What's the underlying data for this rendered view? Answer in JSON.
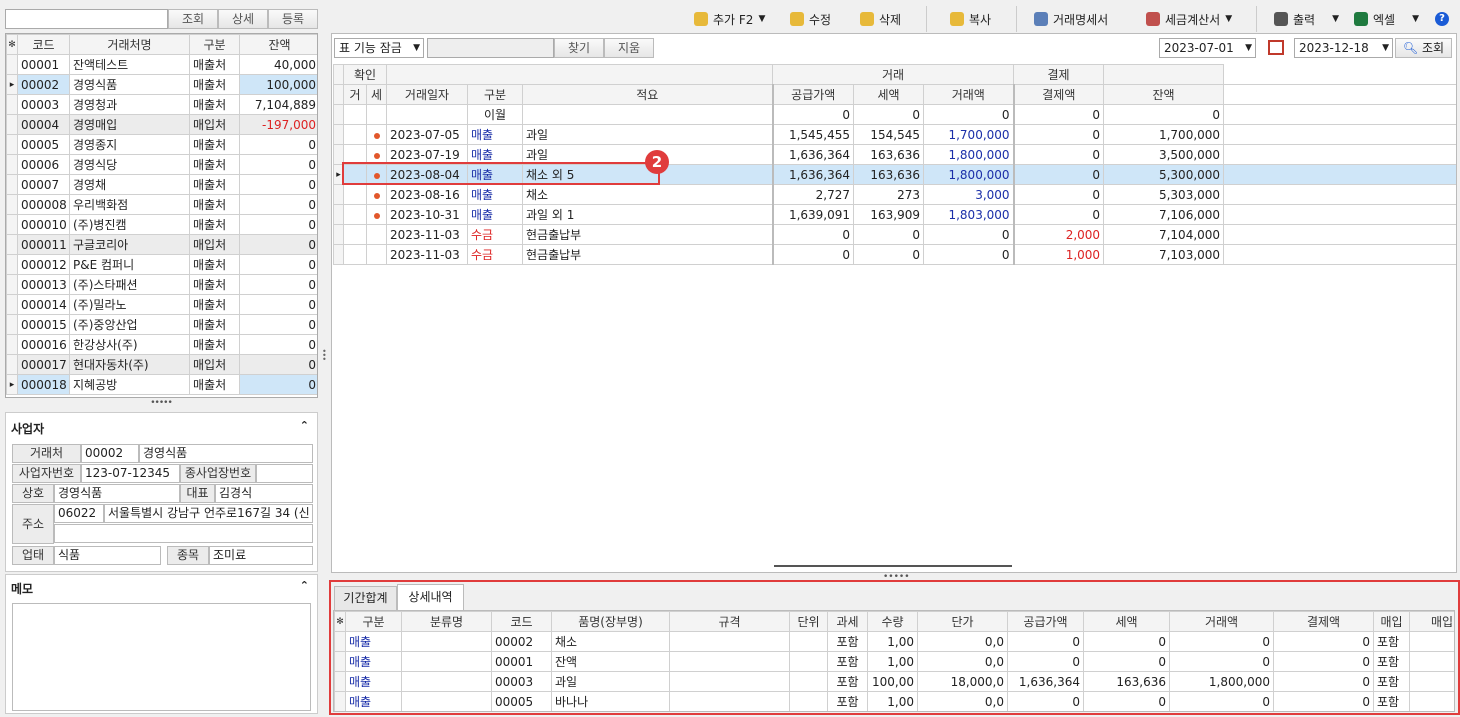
{
  "left": {
    "search_value": "",
    "btn_search": "조회",
    "btn_detail": "상세",
    "btn_register": "등록",
    "headers": [
      "코드",
      "거래처명",
      "구분",
      "잔액"
    ],
    "rows": [
      {
        "code": "00001",
        "name": "잔액테스트",
        "type": "매출처",
        "bal": "40,000"
      },
      {
        "code": "00002",
        "name": "경영식품",
        "type": "매출처",
        "bal": "100,000"
      },
      {
        "code": "00003",
        "name": "경영청과",
        "type": "매출처",
        "bal": "7,104,889"
      },
      {
        "code": "00004",
        "name": "경영매입",
        "type": "매입처",
        "bal": "-197,000"
      },
      {
        "code": "00005",
        "name": "경영종지",
        "type": "매출처",
        "bal": "0"
      },
      {
        "code": "00006",
        "name": "경영식당",
        "type": "매출처",
        "bal": "0"
      },
      {
        "code": "00007",
        "name": "경영채",
        "type": "매출처",
        "bal": "0"
      },
      {
        "code": "000008",
        "name": "우리백화점",
        "type": "매출처",
        "bal": "0"
      },
      {
        "code": "000010",
        "name": "(주)병진캠",
        "type": "매출처",
        "bal": "0"
      },
      {
        "code": "000011",
        "name": "구글코리아",
        "type": "매입처",
        "bal": "0"
      },
      {
        "code": "000012",
        "name": "P&E 컴퍼니",
        "type": "매출처",
        "bal": "0"
      },
      {
        "code": "000013",
        "name": "(주)스타패션",
        "type": "매출처",
        "bal": "0"
      },
      {
        "code": "000014",
        "name": "(주)밀라노",
        "type": "매출처",
        "bal": "0"
      },
      {
        "code": "000015",
        "name": "(주)중앙산업",
        "type": "매출처",
        "bal": "0"
      },
      {
        "code": "000016",
        "name": "한강상사(주)",
        "type": "매출처",
        "bal": "0"
      },
      {
        "code": "000017",
        "name": "현대자동차(주)",
        "type": "매입처",
        "bal": "0"
      },
      {
        "code": "000018",
        "name": "지혜공방",
        "type": "매출처",
        "bal": "0"
      }
    ]
  },
  "biz": {
    "title": "사업자",
    "client_label": "거래처",
    "client_code": "00002",
    "client_name": "경영식품",
    "bizno_label": "사업자번호",
    "bizno": "123-07-12345",
    "subbiz_label": "종사업장번호",
    "subbiz": "",
    "company_label": "상호",
    "company": "경영식품",
    "ceo_label": "대표",
    "ceo": "김경식",
    "addr_label": "주소",
    "zip": "06022",
    "addr": "서울특별시 강남구 언주로167길 34 (신",
    "biztype_label": "업태",
    "biztype": "식품",
    "item_label": "종목",
    "item": "조미료",
    "memo_title": "메모"
  },
  "toolbar": {
    "add": "추가 F2",
    "edit": "수정",
    "delete": "삭제",
    "copy": "복사",
    "statement": "거래명세서",
    "tax_invoice": "세금계산서",
    "print": "출력",
    "excel": "엑셀"
  },
  "filter": {
    "lock": "표 기능 잠금",
    "find": "찾기",
    "clear": "지움",
    "date_from": "2023-07-01",
    "date_to": "2023-12-18",
    "query": "조회"
  },
  "main": {
    "group_confirm": "확인",
    "group_trade": "거래",
    "group_pay": "결제",
    "h_g": "거",
    "h_s": "세",
    "h_date": "거래일자",
    "h_type": "구분",
    "h_memo": "적요",
    "h_supply": "공급가액",
    "h_tax": "세액",
    "h_amount": "거래액",
    "h_payamt": "결제액",
    "h_bal": "잔액",
    "badge": "2",
    "rows": [
      {
        "dot": false,
        "date": "",
        "type": "이월",
        "memo": "",
        "supply": "0",
        "tax": "0",
        "amount": "0",
        "pay": "0",
        "bal": "0"
      },
      {
        "dot": true,
        "date": "2023-07-05",
        "type": "매출",
        "memo": "과일",
        "supply": "1,545,455",
        "tax": "154,545",
        "amount": "1,700,000",
        "pay": "0",
        "bal": "1,700,000"
      },
      {
        "dot": true,
        "date": "2023-07-19",
        "type": "매출",
        "memo": "과일",
        "supply": "1,636,364",
        "tax": "163,636",
        "amount": "1,800,000",
        "pay": "0",
        "bal": "3,500,000"
      },
      {
        "dot": true,
        "date": "2023-08-04",
        "type": "매출",
        "memo": "채소 외 5",
        "supply": "1,636,364",
        "tax": "163,636",
        "amount": "1,800,000",
        "pay": "0",
        "bal": "5,300,000"
      },
      {
        "dot": true,
        "date": "2023-08-16",
        "type": "매출",
        "memo": "채소",
        "supply": "2,727",
        "tax": "273",
        "amount": "3,000",
        "pay": "0",
        "bal": "5,303,000"
      },
      {
        "dot": true,
        "date": "2023-10-31",
        "type": "매출",
        "memo": "과일 외 1",
        "supply": "1,639,091",
        "tax": "163,909",
        "amount": "1,803,000",
        "pay": "0",
        "bal": "7,106,000"
      },
      {
        "dot": false,
        "date": "2023-11-03",
        "type": "수금",
        "memo": "현금출납부",
        "supply": "0",
        "tax": "0",
        "amount": "0",
        "pay": "2,000",
        "bal": "7,104,000"
      },
      {
        "dot": false,
        "date": "2023-11-03",
        "type": "수금",
        "memo": "현금출납부",
        "supply": "0",
        "tax": "0",
        "amount": "0",
        "pay": "1,000",
        "bal": "7,103,000"
      }
    ]
  },
  "bottom": {
    "tab1": "기간합계",
    "tab2": "상세내역",
    "headers": [
      "구분",
      "분류명",
      "코드",
      "품명(장부명)",
      "규격",
      "단위",
      "과세",
      "수량",
      "단가",
      "공급가액",
      "세액",
      "거래액",
      "결제액",
      "매입",
      "매입"
    ],
    "rows": [
      {
        "type": "매출",
        "cat": "",
        "code": "00002",
        "name": "채소",
        "spec": "",
        "unit": "",
        "taxable": "포함",
        "qty": "1,00",
        "price": "0,0",
        "supply": "0",
        "tax": "0",
        "amount": "0",
        "pay": "0",
        "buy": "포함"
      },
      {
        "type": "매출",
        "cat": "",
        "code": "00001",
        "name": "잔액",
        "spec": "",
        "unit": "",
        "taxable": "포함",
        "qty": "1,00",
        "price": "0,0",
        "supply": "0",
        "tax": "0",
        "amount": "0",
        "pay": "0",
        "buy": "포함"
      },
      {
        "type": "매출",
        "cat": "",
        "code": "00003",
        "name": "과일",
        "spec": "",
        "unit": "",
        "taxable": "포함",
        "qty": "100,00",
        "price": "18,000,0",
        "supply": "1,636,364",
        "tax": "163,636",
        "amount": "1,800,000",
        "pay": "0",
        "buy": "포함"
      },
      {
        "type": "매출",
        "cat": "",
        "code": "00005",
        "name": "바나나",
        "spec": "",
        "unit": "",
        "taxable": "포함",
        "qty": "1,00",
        "price": "0,0",
        "supply": "0",
        "tax": "0",
        "amount": "0",
        "pay": "0",
        "buy": "포함"
      }
    ]
  }
}
